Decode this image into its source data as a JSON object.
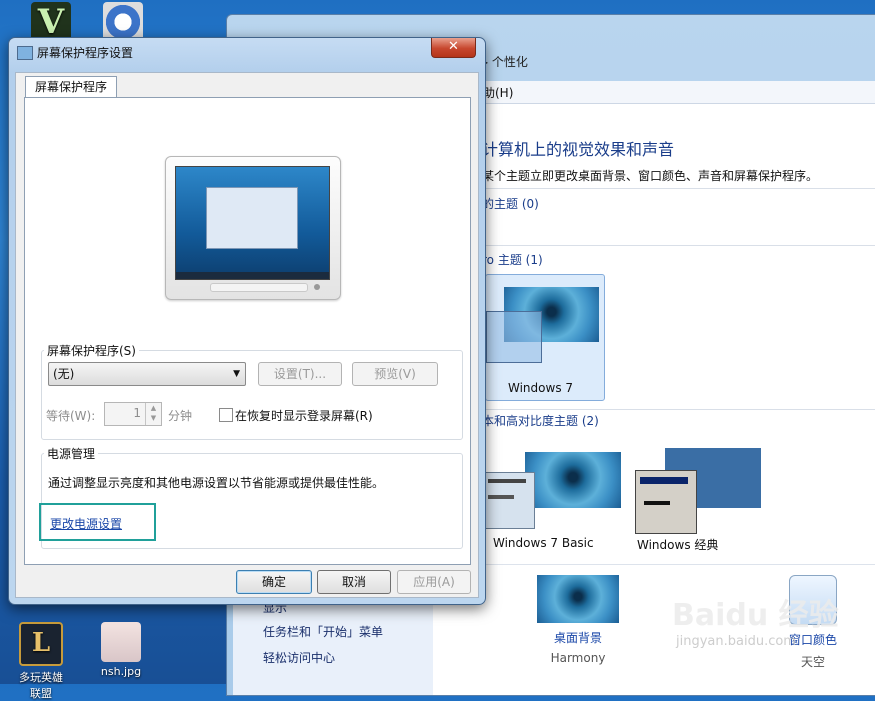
{
  "desktop": {
    "icons": [
      {
        "label": ""
      },
      {
        "label": ""
      },
      {
        "label": "多玩英雄联盟"
      },
      {
        "label": "nsh.jpg"
      }
    ]
  },
  "personalization": {
    "breadcrumb": "个性化",
    "menu": "助(H)",
    "heading": "计算机上的视觉效果和声音",
    "subheading": "某个主题立即更改桌面背景、窗口颜色、声音和屏幕保护程序。",
    "my_themes": "的主题 (0)",
    "aero_themes": "ro 主题 (1)",
    "basic_themes": "本和高对比度主题 (2)",
    "themes": [
      "Windows 7",
      "Windows 7 Basic",
      "Windows 经典"
    ],
    "left_links": [
      "显示",
      "任务栏和「开始」菜单",
      "轻松访问中心"
    ],
    "bottom_items": [
      {
        "label": "桌面背景",
        "sub": "Harmony"
      },
      {
        "label": "窗口颜色",
        "sub": "天空"
      }
    ]
  },
  "dialog": {
    "title": "屏幕保护程序设置",
    "close": "✕",
    "tab": "屏幕保护程序",
    "screensaver_group": "屏幕保护程序(S)",
    "screensaver_value": "(无)",
    "settings_button": "设置(T)...",
    "preview_button": "预览(V)",
    "wait_label": "等待(W):",
    "wait_value": "1",
    "minutes": "分钟",
    "resume_label": "在恢复时显示登录屏幕(R)",
    "power_group": "电源管理",
    "power_text": "通过调整显示亮度和其他电源设置以节省能源或提供最佳性能。",
    "power_link": "更改电源设置",
    "ok": "确定",
    "cancel": "取消",
    "apply": "应用(A)"
  },
  "watermark": {
    "text": "Baidu 经验",
    "sub": "jingyan.baidu.com"
  },
  "colors": {
    "accent_highlight": "#20a09a",
    "link": "#1a47a8"
  }
}
